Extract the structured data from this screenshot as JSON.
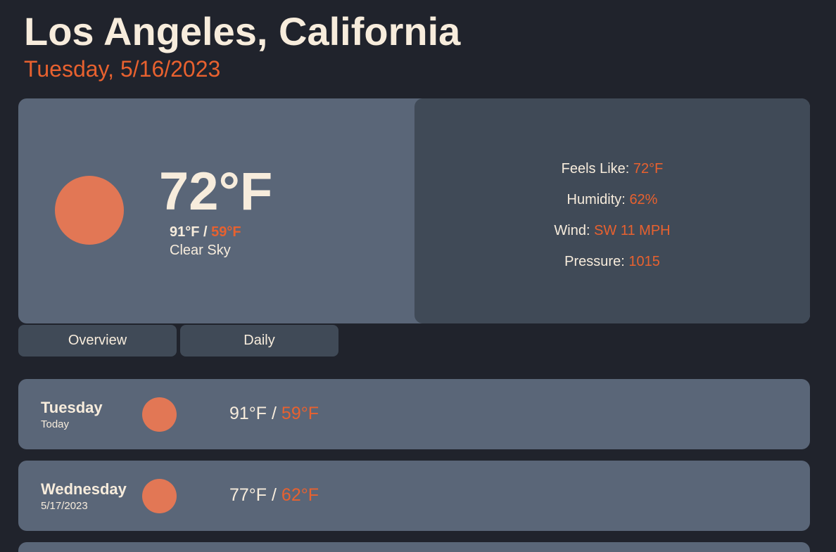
{
  "location": {
    "city": "Los Angeles, California",
    "date": "Tuesday, 5/16/2023"
  },
  "current": {
    "temp": "72°F",
    "high": "91°F",
    "separator": " / ",
    "low": "59°F",
    "condition": "Clear Sky",
    "icon": "sun-icon"
  },
  "details": {
    "feels_like_label": "Feels Like:",
    "feels_like_value": "72°F",
    "humidity_label": "Humidity:",
    "humidity_value": "62%",
    "wind_label": "Wind:",
    "wind_value": "SW 11 MPH",
    "pressure_label": "Pressure:",
    "pressure_value": "1015"
  },
  "tabs": [
    {
      "label": "Overview"
    },
    {
      "label": "Daily"
    }
  ],
  "daily": [
    {
      "day": "Tuesday",
      "sub": "Today",
      "high": "91°F",
      "separator": " / ",
      "low": "59°F",
      "icon": "sun-icon"
    },
    {
      "day": "Wednesday",
      "sub": "5/17/2023",
      "high": "77°F",
      "separator": " / ",
      "low": "62°F",
      "icon": "sun-icon"
    }
  ],
  "colors": {
    "background": "#20232c",
    "card": "#5a6678",
    "card_dark": "#404a57",
    "accent": "#e8612f",
    "sun": "#e27755",
    "text": "#f7ecdc"
  }
}
